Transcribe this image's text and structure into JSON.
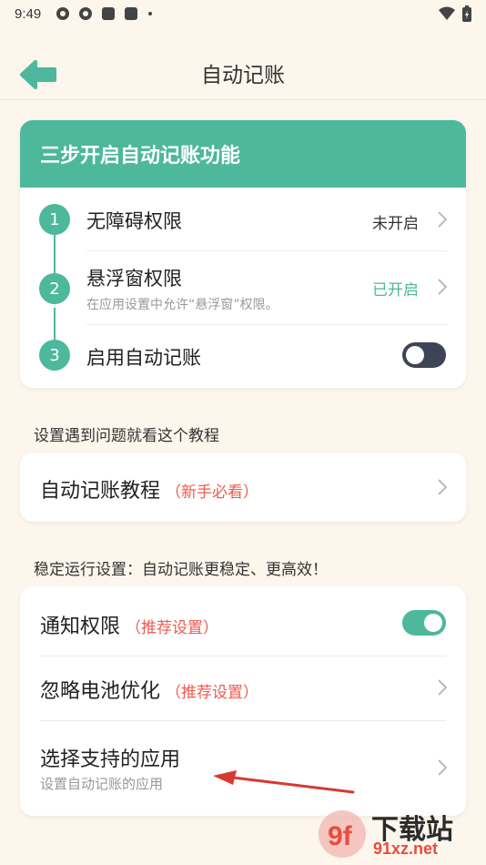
{
  "status_bar": {
    "time": "9:49"
  },
  "header": {
    "title": "自动记账"
  },
  "steps_card": {
    "heading": "三步开启自动记账功能",
    "steps": [
      {
        "number": "1",
        "title": "无障碍权限",
        "status": "未开启"
      },
      {
        "number": "2",
        "title": "悬浮窗权限",
        "subtitle": "在应用设置中允许“悬浮窗”权限。",
        "status": "已开启"
      },
      {
        "number": "3",
        "title": "启用自动记账",
        "toggle": "off"
      }
    ]
  },
  "tutorial_section": {
    "label": "设置遇到问题就看这个教程",
    "item": {
      "title": "自动记账教程",
      "hint": "（新手必看）"
    }
  },
  "stability_section": {
    "label": "稳定运行设置：自动记账更稳定、更高效！",
    "items": [
      {
        "title": "通知权限",
        "hint": "（推荐设置）",
        "toggle": "on"
      },
      {
        "title": "忽略电池优化",
        "hint": "（推荐设置）"
      },
      {
        "title": "选择支持的应用",
        "subtitle": "设置自动记账的应用"
      }
    ]
  },
  "watermark": {
    "big": "下载站",
    "site": "91xz.net",
    "logo_mark": "9f"
  },
  "colors": {
    "accent": "#4db89b",
    "background": "#fcf6ec",
    "hint_red": "#ee5a4f",
    "status_off": "#333333",
    "status_on": "#4db89b"
  }
}
